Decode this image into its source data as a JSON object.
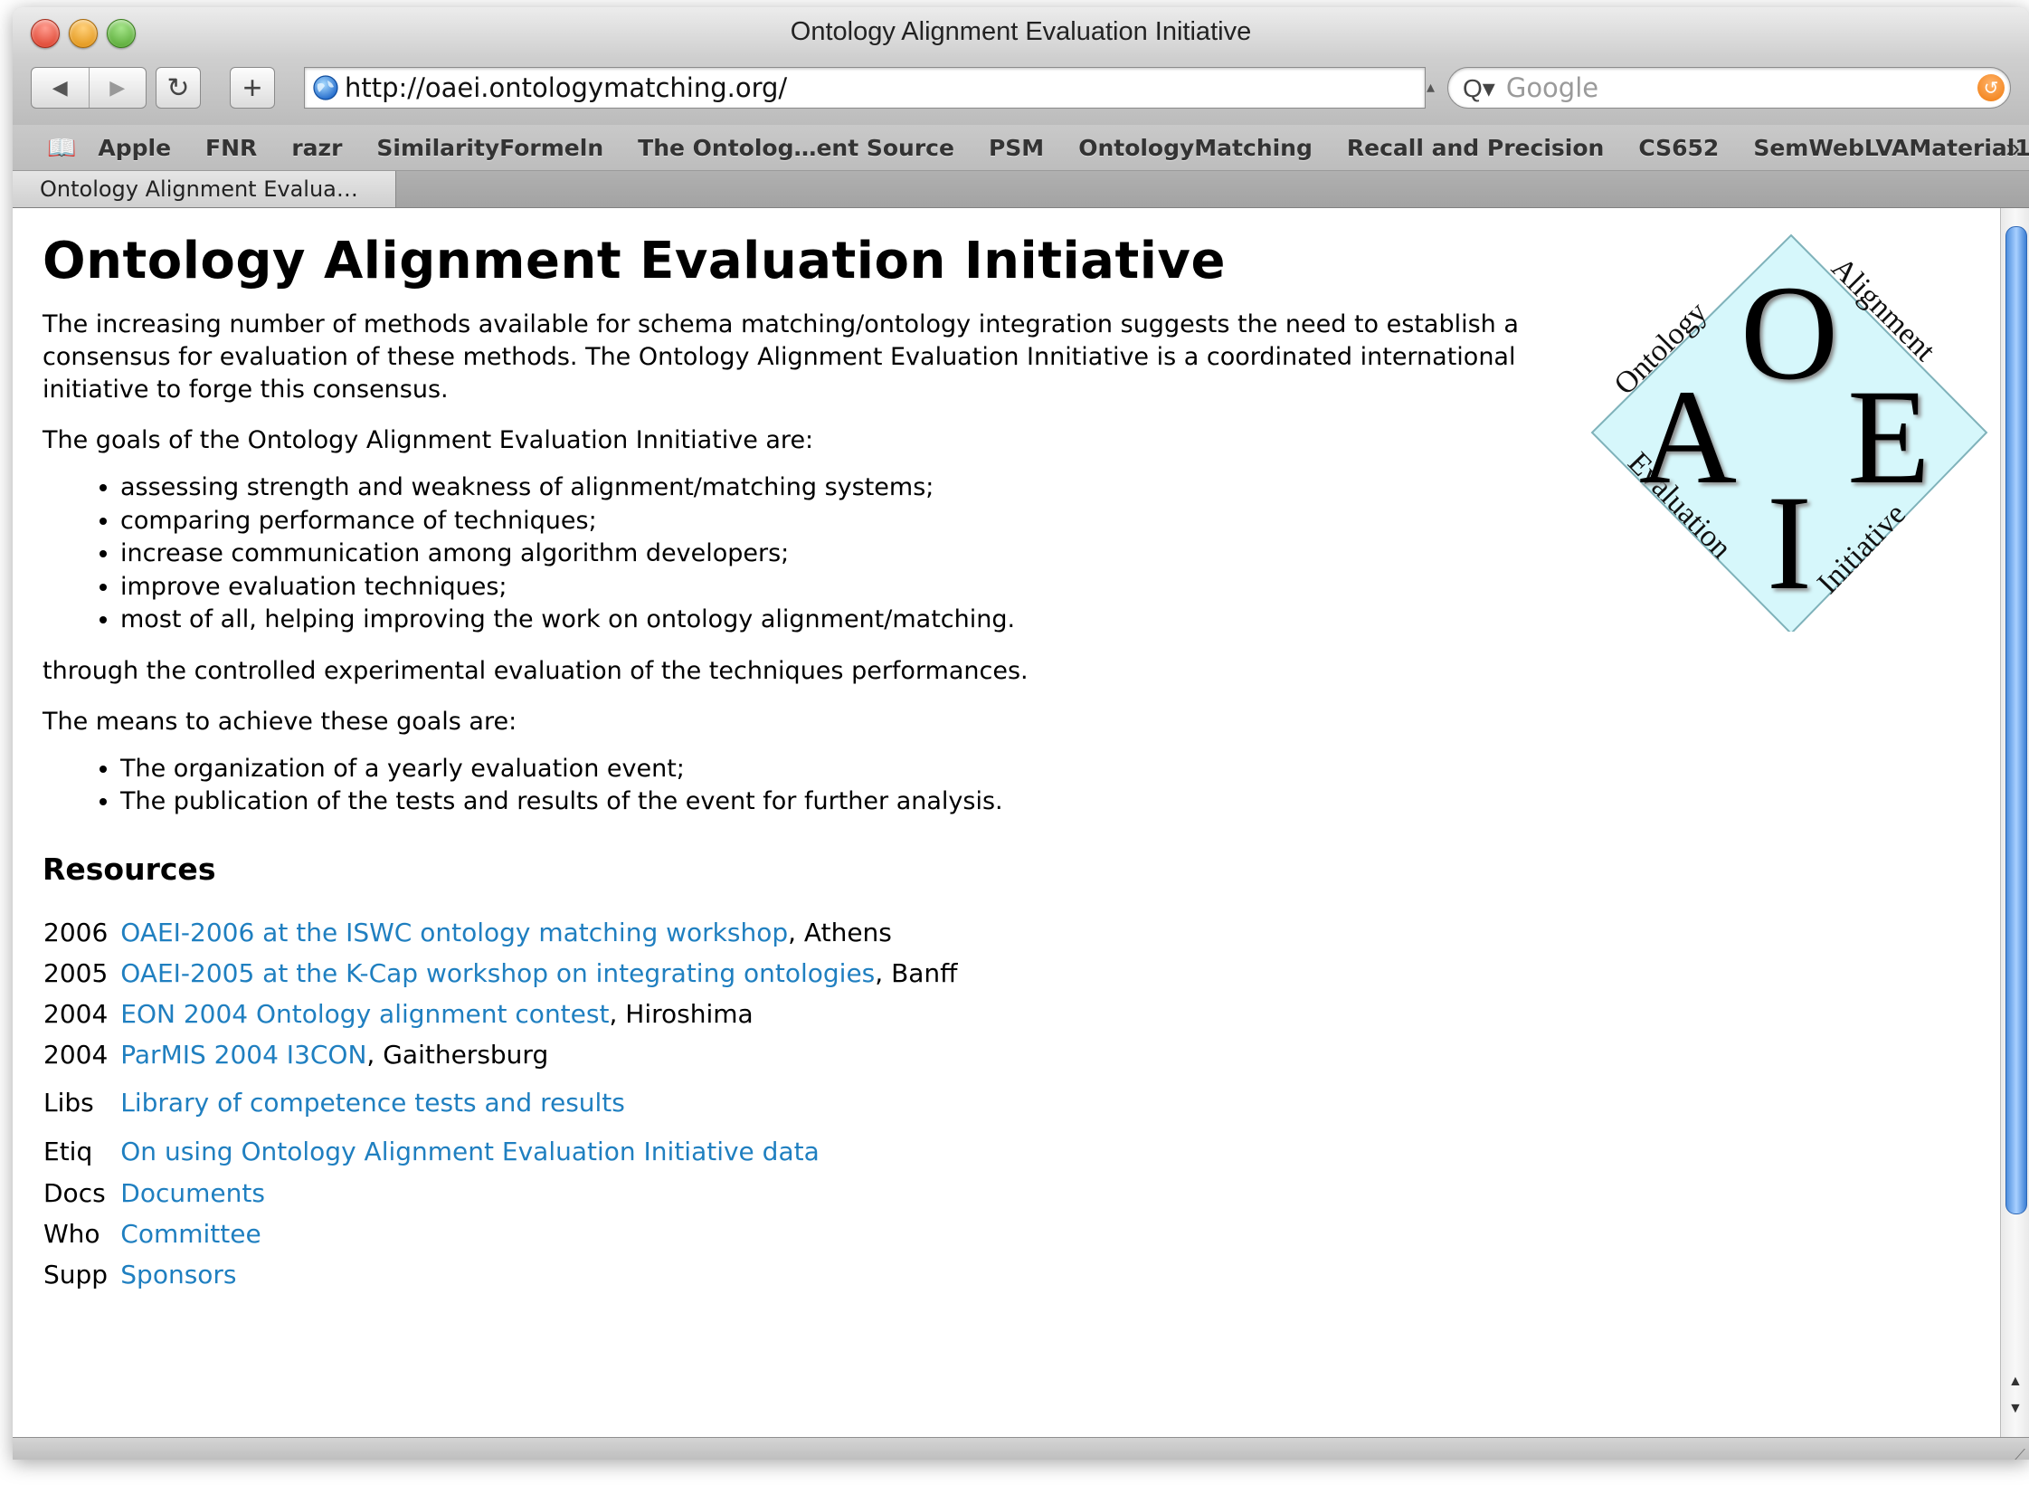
{
  "window": {
    "title": "Ontology Alignment Evaluation Initiative"
  },
  "toolbar": {
    "back_glyph": "◀",
    "forward_glyph": "▶",
    "reload_glyph": "↻",
    "add_glyph": "+",
    "url": "http://oaei.ontologymatching.org/",
    "search_placeholder": "Google",
    "search_icon": "Q▾"
  },
  "bookmarks": {
    "items": [
      "Apple",
      "FNR",
      "razr",
      "SimilarityFormeln",
      "The Ontolog…ent Source",
      "PSM",
      "OntologyMatching",
      "Recall and Precision",
      "CS652",
      "SemWebLVAMaterial1"
    ],
    "more": "»"
  },
  "tabs": [
    "Ontology Alignment Evalua…"
  ],
  "page": {
    "title": "Ontology Alignment Evaluation Initiative",
    "intro": "The increasing number of methods available for schema matching/ontology integration suggests the need to establish a consensus for evaluation of these methods. The Ontology Alignment Evaluation Innitiative is a coordinated international initiative to forge this consensus.",
    "goals_lead": "The goals of the Ontology Alignment Evaluation Innitiative are:",
    "goals": [
      "assessing strength and weakness of alignment/matching systems;",
      "comparing performance of techniques;",
      "increase communication among algorithm developers;",
      "improve evaluation techniques;",
      "most of all, helping improving the work on ontology alignment/matching."
    ],
    "through": "through the controlled experimental evaluation of the techniques performances.",
    "means_lead": "The means to achieve these goals are:",
    "means": [
      "The organization of a yearly evaluation event;",
      "The publication of the tests and results of the event for further analysis."
    ],
    "resources_heading": "Resources",
    "resources": [
      {
        "label": "2006",
        "link": "OAEI-2006 at the ISWC ontology matching workshop",
        "suffix": ", Athens"
      },
      {
        "label": "2005",
        "link": "OAEI-2005 at the K-Cap workshop on integrating ontologies",
        "suffix": ", Banff"
      },
      {
        "label": "2004",
        "link": "EON 2004 Ontology alignment contest",
        "suffix": ", Hiroshima"
      },
      {
        "label": "2004",
        "link": "ParMIS 2004 I3CON",
        "suffix": ", Gaithersburg"
      },
      {
        "label": "Libs",
        "link": "Library of competence tests and results",
        "suffix": ""
      },
      {
        "label": "Etiq",
        "link": "On using Ontology Alignment Evaluation Initiative data",
        "suffix": ""
      },
      {
        "label": "Docs",
        "link": "Documents",
        "suffix": ""
      },
      {
        "label": "Who",
        "link": "Committee",
        "suffix": ""
      },
      {
        "label": "Supp",
        "link": "Sponsors",
        "suffix": ""
      }
    ],
    "logo": {
      "top_left": "Ontology",
      "top_right": "Alignment",
      "bottom_left": "Evaluation",
      "bottom_right": "Initiative",
      "letters": [
        "O",
        "A",
        "E",
        "I"
      ]
    }
  },
  "colors": {
    "link": "#1f7fc0",
    "logo_fill": "#d6f7fb"
  }
}
